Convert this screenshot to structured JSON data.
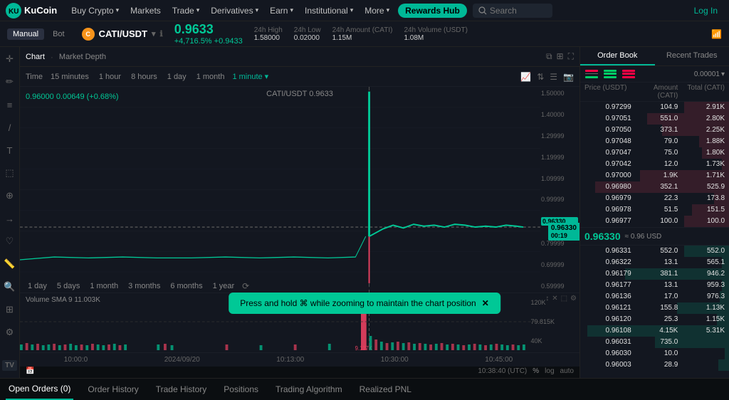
{
  "nav": {
    "logo": "KuCoin",
    "items": [
      {
        "label": "Buy Crypto",
        "hasDropdown": true
      },
      {
        "label": "Markets",
        "hasDropdown": false
      },
      {
        "label": "Trade",
        "hasDropdown": true
      },
      {
        "label": "Derivatives",
        "hasDropdown": true
      },
      {
        "label": "Earn",
        "hasDropdown": true
      },
      {
        "label": "Institutional",
        "hasDropdown": true
      },
      {
        "label": "More",
        "hasDropdown": true
      }
    ],
    "rewards_hub": "Rewards Hub",
    "search_placeholder": "Search",
    "login": "Log In"
  },
  "ticker": {
    "mode_manual": "Manual",
    "mode_bot": "Bot",
    "pair": "CATI/USDT",
    "price": "0.9633",
    "change_pct": "+4,716.5%",
    "change_abs": "+0.9433",
    "high_label": "24h High",
    "high_val": "1.58000",
    "low_label": "24h Low",
    "low_val": "0.02000",
    "amount_label": "24h Amount (CATI)",
    "amount_val": "1.15M",
    "volume_label": "24h Volume (USDT)",
    "volume_val": "1.08M"
  },
  "chart": {
    "tab_chart": "Chart",
    "tab_depth": "Market Depth",
    "pair_label": "CATI/USDT  0.9633",
    "time_label": "Time",
    "time_options": [
      "15 minutes",
      "1 hour",
      "8 hours",
      "1 day",
      "1 month"
    ],
    "active_time": "1 minute",
    "overlay_price": "0.96000  0.00649 (+0.68%)",
    "price_tag": "0.96330",
    "price_tag_sub": "00:19",
    "volume_label": "Volume SMA 9",
    "volume_val": "11.003K",
    "x_labels": [
      "10:00:0",
      "2024/09/20",
      "10:13:00",
      "10:30:00",
      "10:45:00"
    ],
    "bottom_date": "10:38:40 (UTC)",
    "bottom_pct": "%",
    "bottom_log": "log",
    "bottom_auto": "auto"
  },
  "orderbook": {
    "tab_book": "Order Book",
    "tab_trades": "Recent Trades",
    "decimals": "0.00001",
    "header": [
      "Price (USDT)",
      "Amount (CATI)",
      "Total (CATI)"
    ],
    "asks": [
      {
        "price": "0.97299",
        "amount": "104.9",
        "total": "2.91K"
      },
      {
        "price": "0.97051",
        "amount": "551.0",
        "total": "2.80K"
      },
      {
        "price": "0.97050",
        "amount": "373.1",
        "total": "2.25K"
      },
      {
        "price": "0.97048",
        "amount": "79.0",
        "total": "1.88K"
      },
      {
        "price": "0.97047",
        "amount": "75.0",
        "total": "1.80K"
      },
      {
        "price": "0.97042",
        "amount": "12.0",
        "total": "1.73K"
      },
      {
        "price": "0.97000",
        "amount": "1.9K",
        "total": "1.71K"
      },
      {
        "price": "0.96980",
        "amount": "352.1",
        "total": "525.9"
      },
      {
        "price": "0.96979",
        "amount": "22.3",
        "total": "173.8"
      },
      {
        "price": "0.96978",
        "amount": "51.5",
        "total": "151.5"
      },
      {
        "price": "0.96977",
        "amount": "100.0",
        "total": "100.0"
      }
    ],
    "mid_price": "0.96330",
    "mid_usd": "≈ 0.96 USD",
    "bids": [
      {
        "price": "0.96331",
        "amount": "552.0",
        "total": "552.0"
      },
      {
        "price": "0.96322",
        "amount": "13.1",
        "total": "565.1"
      },
      {
        "price": "0.96179",
        "amount": "381.1",
        "total": "946.2"
      },
      {
        "price": "0.96177",
        "amount": "13.1",
        "total": "959.3"
      },
      {
        "price": "0.96136",
        "amount": "17.0",
        "total": "976.3"
      },
      {
        "price": "0.96121",
        "amount": "155.8",
        "total": "1.13K"
      },
      {
        "price": "0.96120",
        "amount": "25.3",
        "total": "1.15K"
      },
      {
        "price": "0.96108",
        "amount": "4.15K",
        "total": "5.31K"
      },
      {
        "price": "0.96031",
        "amount": "735.0",
        "total": ""
      },
      {
        "price": "0.96030",
        "amount": "10.0",
        "total": ""
      },
      {
        "price": "0.96003",
        "amount": "28.9",
        "total": ""
      }
    ]
  },
  "toast": {
    "message": "Press and hold ⌘ while zooming to maintain the chart position"
  },
  "bottom_tabs": [
    {
      "label": "Open Orders (0)",
      "active": true
    },
    {
      "label": "Order History"
    },
    {
      "label": "Trade History"
    },
    {
      "label": "Positions"
    },
    {
      "label": "Trading Algorithm"
    },
    {
      "label": "Realized PNL"
    }
  ],
  "toolbar": {
    "time_periods": [
      "1 day",
      "5 days",
      "1 month",
      "3 months",
      "6 months",
      "1 year"
    ]
  }
}
